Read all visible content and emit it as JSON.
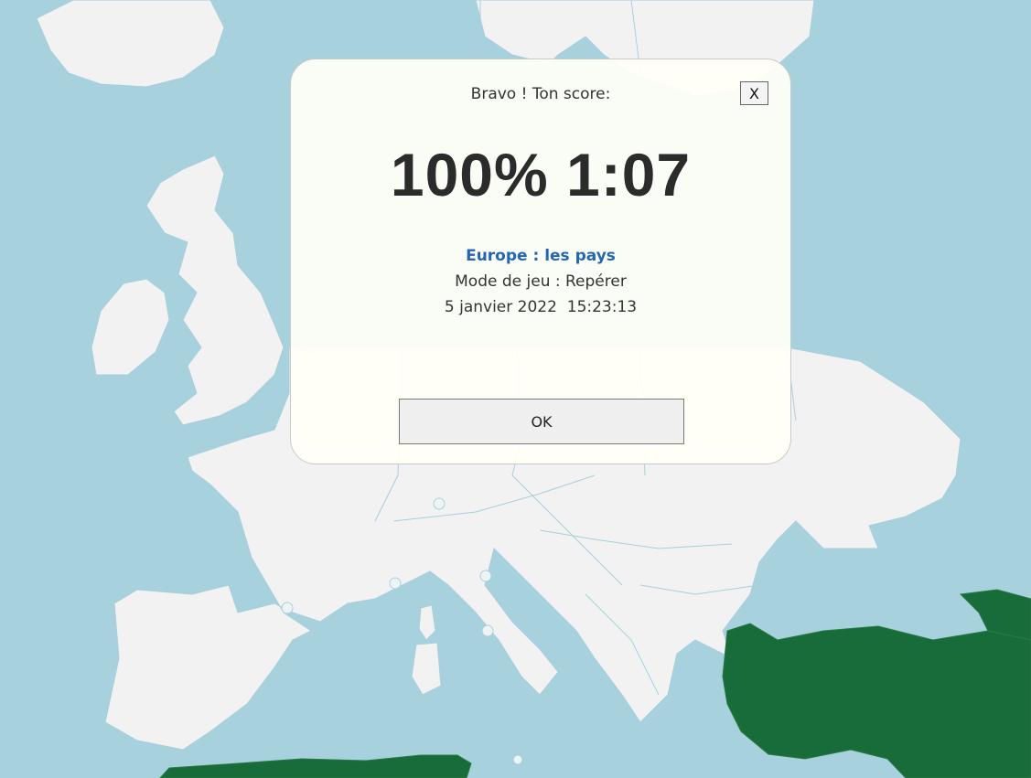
{
  "dialog": {
    "title": "Bravo ! Ton score:",
    "close_label": "X",
    "score_percent": "100%",
    "score_time": "1:07",
    "game_title": "Europe : les pays",
    "game_mode": "Mode de jeu : Repérer",
    "date": "5 janvier 2022",
    "time": "15:23:13",
    "ok_label": "OK"
  },
  "colors": {
    "sea": "#a8d1de",
    "land": "#f2f2f3",
    "found_country": "#176c3a",
    "dialog_bg": "#fffff6",
    "game_title": "#2566b3"
  }
}
